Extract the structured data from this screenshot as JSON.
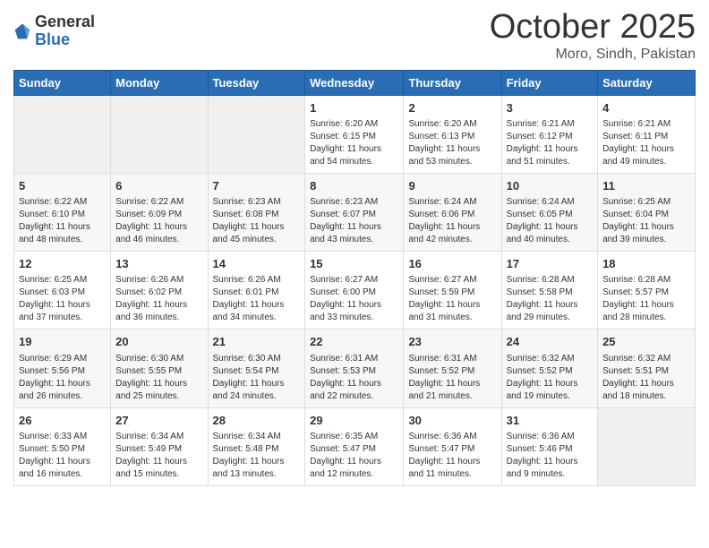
{
  "header": {
    "logo_general": "General",
    "logo_blue": "Blue",
    "month_title": "October 2025",
    "location": "Moro, Sindh, Pakistan"
  },
  "days_of_week": [
    "Sunday",
    "Monday",
    "Tuesday",
    "Wednesday",
    "Thursday",
    "Friday",
    "Saturday"
  ],
  "weeks": [
    [
      {
        "day": "",
        "info": ""
      },
      {
        "day": "",
        "info": ""
      },
      {
        "day": "",
        "info": ""
      },
      {
        "day": "1",
        "info": "Sunrise: 6:20 AM\nSunset: 6:15 PM\nDaylight: 11 hours\nand 54 minutes."
      },
      {
        "day": "2",
        "info": "Sunrise: 6:20 AM\nSunset: 6:13 PM\nDaylight: 11 hours\nand 53 minutes."
      },
      {
        "day": "3",
        "info": "Sunrise: 6:21 AM\nSunset: 6:12 PM\nDaylight: 11 hours\nand 51 minutes."
      },
      {
        "day": "4",
        "info": "Sunrise: 6:21 AM\nSunset: 6:11 PM\nDaylight: 11 hours\nand 49 minutes."
      }
    ],
    [
      {
        "day": "5",
        "info": "Sunrise: 6:22 AM\nSunset: 6:10 PM\nDaylight: 11 hours\nand 48 minutes."
      },
      {
        "day": "6",
        "info": "Sunrise: 6:22 AM\nSunset: 6:09 PM\nDaylight: 11 hours\nand 46 minutes."
      },
      {
        "day": "7",
        "info": "Sunrise: 6:23 AM\nSunset: 6:08 PM\nDaylight: 11 hours\nand 45 minutes."
      },
      {
        "day": "8",
        "info": "Sunrise: 6:23 AM\nSunset: 6:07 PM\nDaylight: 11 hours\nand 43 minutes."
      },
      {
        "day": "9",
        "info": "Sunrise: 6:24 AM\nSunset: 6:06 PM\nDaylight: 11 hours\nand 42 minutes."
      },
      {
        "day": "10",
        "info": "Sunrise: 6:24 AM\nSunset: 6:05 PM\nDaylight: 11 hours\nand 40 minutes."
      },
      {
        "day": "11",
        "info": "Sunrise: 6:25 AM\nSunset: 6:04 PM\nDaylight: 11 hours\nand 39 minutes."
      }
    ],
    [
      {
        "day": "12",
        "info": "Sunrise: 6:25 AM\nSunset: 6:03 PM\nDaylight: 11 hours\nand 37 minutes."
      },
      {
        "day": "13",
        "info": "Sunrise: 6:26 AM\nSunset: 6:02 PM\nDaylight: 11 hours\nand 36 minutes."
      },
      {
        "day": "14",
        "info": "Sunrise: 6:26 AM\nSunset: 6:01 PM\nDaylight: 11 hours\nand 34 minutes."
      },
      {
        "day": "15",
        "info": "Sunrise: 6:27 AM\nSunset: 6:00 PM\nDaylight: 11 hours\nand 33 minutes."
      },
      {
        "day": "16",
        "info": "Sunrise: 6:27 AM\nSunset: 5:59 PM\nDaylight: 11 hours\nand 31 minutes."
      },
      {
        "day": "17",
        "info": "Sunrise: 6:28 AM\nSunset: 5:58 PM\nDaylight: 11 hours\nand 29 minutes."
      },
      {
        "day": "18",
        "info": "Sunrise: 6:28 AM\nSunset: 5:57 PM\nDaylight: 11 hours\nand 28 minutes."
      }
    ],
    [
      {
        "day": "19",
        "info": "Sunrise: 6:29 AM\nSunset: 5:56 PM\nDaylight: 11 hours\nand 26 minutes."
      },
      {
        "day": "20",
        "info": "Sunrise: 6:30 AM\nSunset: 5:55 PM\nDaylight: 11 hours\nand 25 minutes."
      },
      {
        "day": "21",
        "info": "Sunrise: 6:30 AM\nSunset: 5:54 PM\nDaylight: 11 hours\nand 24 minutes."
      },
      {
        "day": "22",
        "info": "Sunrise: 6:31 AM\nSunset: 5:53 PM\nDaylight: 11 hours\nand 22 minutes."
      },
      {
        "day": "23",
        "info": "Sunrise: 6:31 AM\nSunset: 5:52 PM\nDaylight: 11 hours\nand 21 minutes."
      },
      {
        "day": "24",
        "info": "Sunrise: 6:32 AM\nSunset: 5:52 PM\nDaylight: 11 hours\nand 19 minutes."
      },
      {
        "day": "25",
        "info": "Sunrise: 6:32 AM\nSunset: 5:51 PM\nDaylight: 11 hours\nand 18 minutes."
      }
    ],
    [
      {
        "day": "26",
        "info": "Sunrise: 6:33 AM\nSunset: 5:50 PM\nDaylight: 11 hours\nand 16 minutes."
      },
      {
        "day": "27",
        "info": "Sunrise: 6:34 AM\nSunset: 5:49 PM\nDaylight: 11 hours\nand 15 minutes."
      },
      {
        "day": "28",
        "info": "Sunrise: 6:34 AM\nSunset: 5:48 PM\nDaylight: 11 hours\nand 13 minutes."
      },
      {
        "day": "29",
        "info": "Sunrise: 6:35 AM\nSunset: 5:47 PM\nDaylight: 11 hours\nand 12 minutes."
      },
      {
        "day": "30",
        "info": "Sunrise: 6:36 AM\nSunset: 5:47 PM\nDaylight: 11 hours\nand 11 minutes."
      },
      {
        "day": "31",
        "info": "Sunrise: 6:36 AM\nSunset: 5:46 PM\nDaylight: 11 hours\nand 9 minutes."
      },
      {
        "day": "",
        "info": ""
      }
    ]
  ]
}
